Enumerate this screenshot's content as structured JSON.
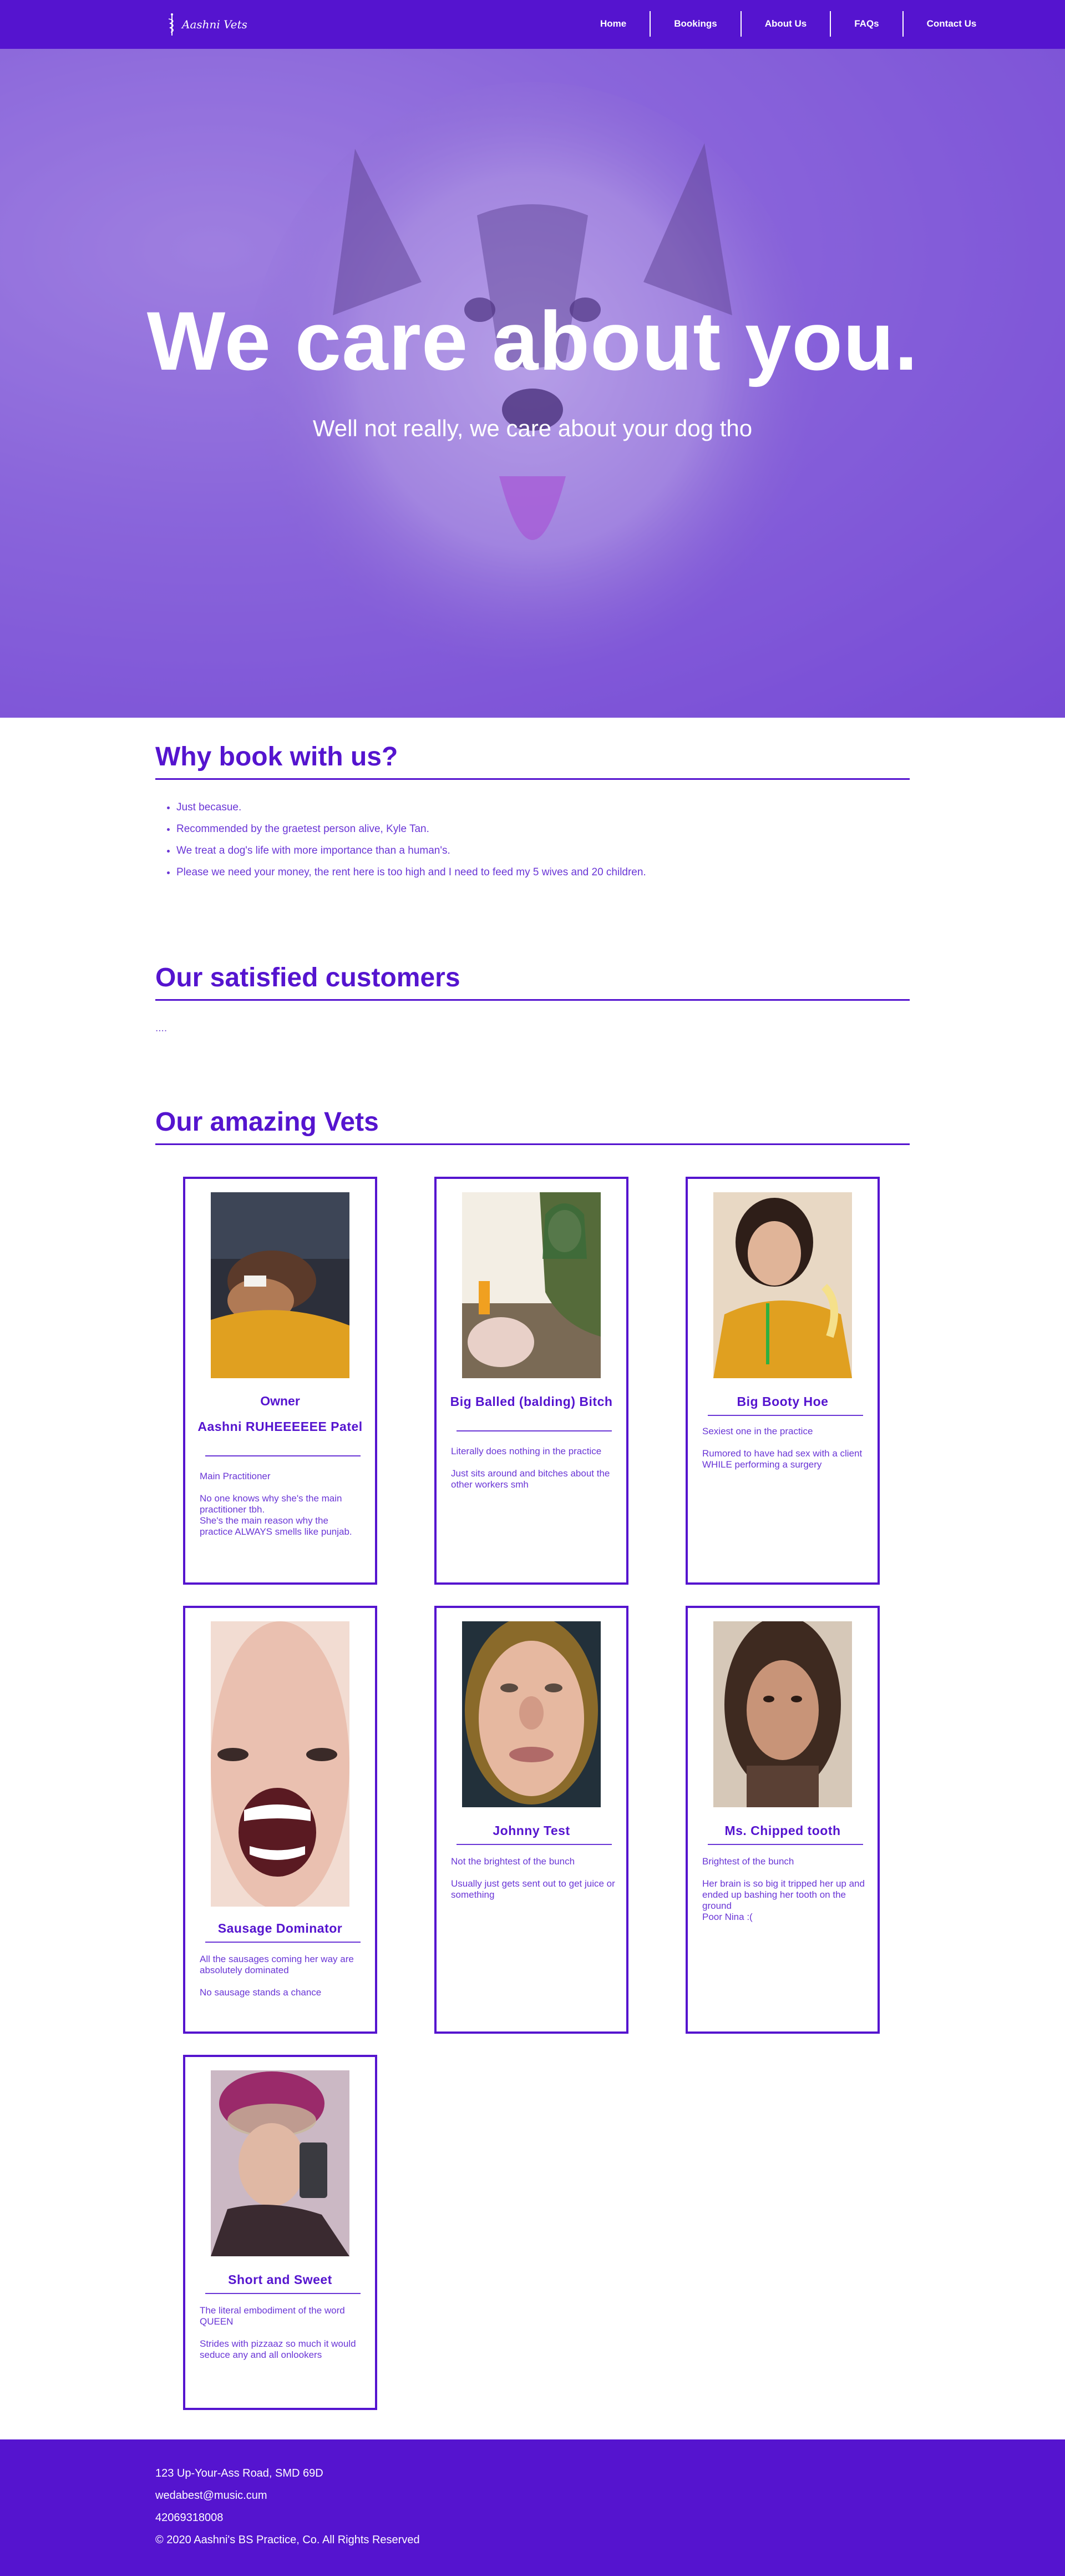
{
  "nav": {
    "logo_text": "Aashni Vets",
    "links": [
      "Home",
      "Bookings",
      "About Us",
      "FAQs",
      "Contact Us"
    ]
  },
  "hero": {
    "title": "We care about you.",
    "subtitle": "Well not really, we care about your dog tho"
  },
  "why": {
    "title": "Why book with us?",
    "items": [
      "Just becasue.",
      "Recommended by the graetest person alive, Kyle Tan.",
      "We treat a dog's life with more importance than a human's.",
      "Please we need your money, the rent here is too high and I need to feed my 5 wives and 20 children."
    ]
  },
  "customers": {
    "title": "Our satisfied customers",
    "text": "...."
  },
  "vets": {
    "title": "Our amazing Vets",
    "cards": [
      {
        "role": "Owner",
        "name": "Aashni RUHEEEEEE Patel",
        "desc": "Main Practitioner\n\nNo one knows why she's the main practitioner tbh.\nShe's the main reason why the practice ALWAYS smells like punjab."
      },
      {
        "role": "",
        "name": "Big Balled (balding) Bitch",
        "desc": "Literally does nothing in the practice\n\nJust sits around and bitches about the other workers smh"
      },
      {
        "role": "",
        "name": "Big Booty Hoe",
        "desc": "Sexiest one in the practice\n\nRumored to have had sex with a client WHILE performing a surgery"
      },
      {
        "role": "",
        "name": "Sausage Dominator",
        "desc": "All the sausages coming her way are absolutely dominated\n\nNo sausage stands a chance"
      },
      {
        "role": "",
        "name": "Johnny Test",
        "desc": "Not the brightest of the bunch\n\nUsually just gets sent out to get juice or something"
      },
      {
        "role": "",
        "name": "Ms. Chipped tooth",
        "desc": "Brightest of the bunch\n\nHer brain is so big it tripped her up and ended up bashing her tooth on the ground\nPoor Nina :("
      },
      {
        "role": "",
        "name": "Short and Sweet",
        "desc": "The literal embodiment of the word QUEEN\n\nStrides with pizzaaz so much it would seduce any and all onlookers"
      }
    ]
  },
  "footer": {
    "address": "123 Up-Your-Ass Road, SMD 69D",
    "email": "wedabest@music.cum",
    "phone": "42069318008",
    "copyright": "© 2020 Aashni's BS Practice, Co. All Rights Reserved"
  },
  "colors": {
    "brand": "#5514cf",
    "text": "#6a36d6",
    "white": "#ffffff"
  }
}
